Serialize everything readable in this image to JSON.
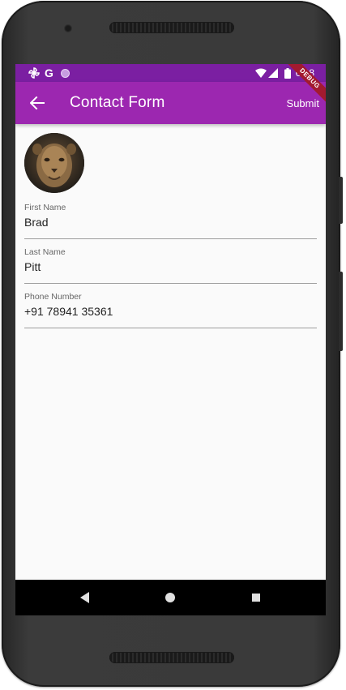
{
  "status_bar": {
    "google_glyph": "G",
    "time": "6:08",
    "icons": [
      "pinwheel-icon",
      "google-icon",
      "circle-icon",
      "wifi-icon",
      "signal-icon",
      "battery-icon"
    ]
  },
  "app_bar": {
    "title": "Contact Form",
    "submit_label": "Submit",
    "back_icon": "arrow-left-icon",
    "debug_banner": "DEBUG"
  },
  "form": {
    "avatar_icon": "lion-photo",
    "fields": [
      {
        "label": "First Name",
        "value": "Brad"
      },
      {
        "label": "Last Name",
        "value": "Pitt"
      },
      {
        "label": "Phone Number",
        "value": "+91 78941 35361"
      }
    ]
  },
  "nav_bar": {
    "icons": [
      "back-triangle-icon",
      "home-circle-icon",
      "recents-square-icon"
    ]
  },
  "colors": {
    "status_bar": "#7b1fa2",
    "app_bar": "#9c27b0",
    "background": "#fafafa",
    "debug_ribbon": "#a31a2f"
  }
}
